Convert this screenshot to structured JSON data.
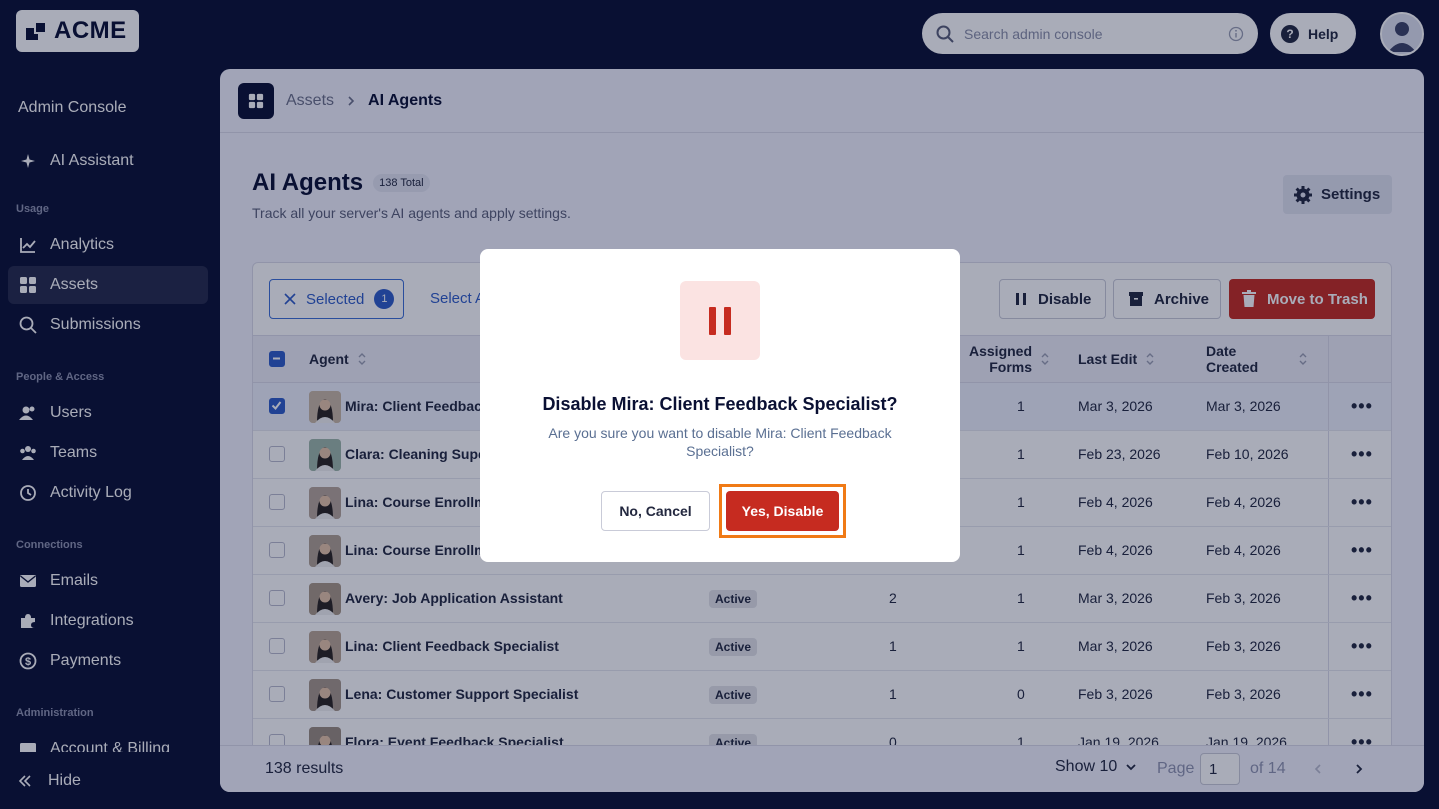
{
  "brand": {
    "name": "ACME"
  },
  "topbar": {
    "search_placeholder": "Search admin console",
    "help_label": "Help"
  },
  "sidebar": {
    "title": "Admin Console",
    "assistant": "AI Assistant",
    "sections": {
      "usage": "Usage",
      "people": "People & Access",
      "connections": "Connections",
      "admin": "Administration"
    },
    "items": {
      "analytics": "Analytics",
      "assets": "Assets",
      "submissions": "Submissions",
      "users": "Users",
      "teams": "Teams",
      "activity": "Activity Log",
      "emails": "Emails",
      "integrations": "Integrations",
      "payments": "Payments",
      "billing": "Account & Billing"
    },
    "hide": "Hide"
  },
  "breadcrumb": {
    "parent": "Assets",
    "current": "AI Agents"
  },
  "page": {
    "title": "AI Agents",
    "total_badge": "138 Total",
    "subtitle": "Track all your server's AI agents and apply settings.",
    "settings_label": "Settings"
  },
  "toolbar": {
    "selected_label": "Selected",
    "selected_count": "1",
    "select_all": "Select A",
    "disable": "Disable",
    "archive": "Archive",
    "trash": "Move to Trash"
  },
  "table": {
    "headers": {
      "agent": "Agent",
      "assigned_1": "Assigned",
      "assigned_2": "Forms",
      "last_edit": "Last Edit",
      "date_1": "Date",
      "date_2": "Created"
    },
    "rows": [
      {
        "name": "Mira: Client Feedbac",
        "status": "",
        "col3": "",
        "forms": "1",
        "last_edit": "Mar 3, 2026",
        "created": "Mar 3, 2026"
      },
      {
        "name": "Clara: Cleaning Supe",
        "status": "",
        "col3": "",
        "forms": "1",
        "last_edit": "Feb 23, 2026",
        "created": "Feb 10, 2026"
      },
      {
        "name": "Lina: Course Enrollm",
        "status": "",
        "col3": "",
        "forms": "1",
        "last_edit": "Feb 4, 2026",
        "created": "Feb 4, 2026"
      },
      {
        "name": "Lina: Course Enrollm",
        "status": "",
        "col3": "",
        "forms": "1",
        "last_edit": "Feb 4, 2026",
        "created": "Feb 4, 2026"
      },
      {
        "name": "Avery: Job Application Assistant",
        "status": "Active",
        "col3": "2",
        "forms": "1",
        "last_edit": "Mar 3, 2026",
        "created": "Feb 3, 2026"
      },
      {
        "name": "Lina: Client Feedback Specialist",
        "status": "Active",
        "col3": "1",
        "forms": "1",
        "last_edit": "Mar 3, 2026",
        "created": "Feb 3, 2026"
      },
      {
        "name": "Lena: Customer Support Specialist",
        "status": "Active",
        "col3": "1",
        "forms": "0",
        "last_edit": "Feb 3, 2026",
        "created": "Feb 3, 2026"
      },
      {
        "name": "Flora: Event Feedback Specialist",
        "status": "Active",
        "col3": "0",
        "forms": "1",
        "last_edit": "Jan 19, 2026",
        "created": "Jan 19, 2026"
      }
    ]
  },
  "footer": {
    "results": "138 results",
    "show": "Show 10",
    "page_label": "Page",
    "page_value": "1",
    "of": "of 14"
  },
  "modal": {
    "title": "Disable Mira: Client Feedback Specialist?",
    "message": "Are you sure you want to disable Mira: Client Feedback Specialist?",
    "cancel": "No, Cancel",
    "confirm": "Yes, Disable"
  },
  "colors": {
    "navy": "#0a1033",
    "danger": "#c62b20",
    "accent": "#2e5cc8",
    "focus": "#f07a16"
  }
}
